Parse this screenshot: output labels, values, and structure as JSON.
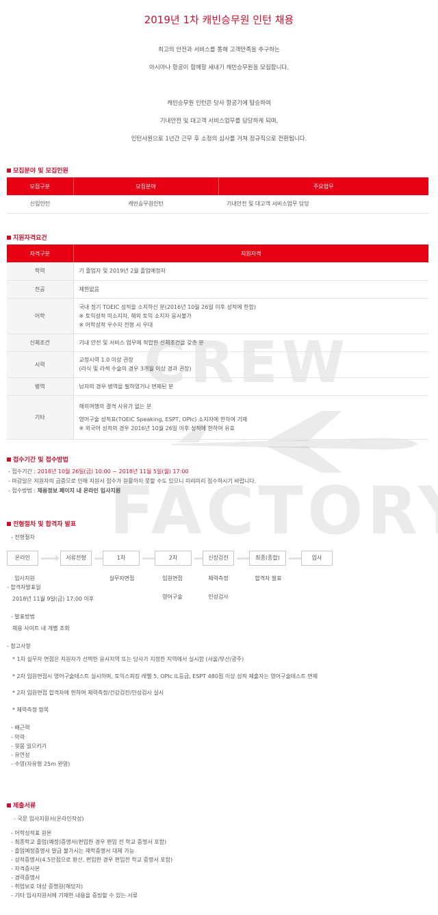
{
  "title": "2019년 1차 캐빈승무원 인턴 채용",
  "intro": [
    "최고의 안전과 서비스를 통해 고객만족을 추구하는",
    "아시아나 항공이 함께할 새내기 캐빈승무원을 모집합니다.",
    "캐빈승무원 인턴은 당사 항공기에 탑승하여",
    "기내안전 및 대고객 서비스업무를 담당하게 되며,",
    "인턴사원으로 1년간 근무 후 소정의 심사를 거쳐 정규직으로 전환됩니다."
  ],
  "watermark": {
    "line1": "CREW",
    "line2": "FACTORY"
  },
  "section1": {
    "title": "모집분야 및 모집인원",
    "headers": [
      "모집구분",
      "모집분야",
      "주요업무"
    ],
    "rows": [
      [
        "신입인턴",
        "캐빈승무원인턴",
        "기내안전 및 대고객 서비스업무 담당"
      ]
    ]
  },
  "section2": {
    "title": "지원자격요건",
    "headers": [
      "자격구분",
      "지원자격"
    ],
    "rows": [
      {
        "label": "학력",
        "lines": [
          "기 졸업자 및 2019년 2월 졸업예정자"
        ]
      },
      {
        "label": "전공",
        "lines": [
          "제한없음"
        ]
      },
      {
        "label": "어학",
        "lines": [
          "국내 정기 TOEIC 성적을 소지하신 분(2016년 10월 26일 이후 성적에 한함)",
          "※ 토익성적 미소지자, 해외 토익 소지자 응시불가",
          "※ 어학성적 우수자 전형 시 우대"
        ]
      },
      {
        "label": "신체조건",
        "lines": [
          "기내 안전 및 서비스 업무에 적합한 신체조건을 갖춘 분"
        ]
      },
      {
        "label": "시력",
        "lines": [
          "교정시력 1.0 이상 권장",
          "(라식 및 라섹 수술의 경우 3개월 이상 경과 권장)"
        ]
      },
      {
        "label": "병역",
        "lines": [
          "남자의 경우 병역을 필하였거나 면제된 분"
        ]
      },
      {
        "label": "기타",
        "lines": [
          "해외여행의 결격 사유가 없는 분",
          "",
          "영어구술 성적표(TOEIC Speaking, ESPT, OPIc) 소지자에 한하여 기재",
          "※ 외국어 성적의 경우 2016년 10월 26일 이후 성적에 한하여 유효"
        ]
      }
    ]
  },
  "section3": {
    "title": "접수기간 및 접수방법",
    "period_label": "- 접수기간 : ",
    "period_value": "2018년 10월 26일(금) 10:00 ~ 2018년 11월 5일(월) 17:00",
    "notice": "- 마감일은 지원자의 급증으로 인해 지원서 접수가 원활하지 못할 수도 있으니 미리미리 접수하시기 바랍니다.",
    "method_label": "- 접수방법 : ",
    "method_value": "채용정보 페이지 내 온라인 입사지원"
  },
  "section4": {
    "title": "전형절차 및 합격자 발표",
    "process_label": "- 전형절차",
    "steps": [
      "온라인",
      "서류전형",
      "1차",
      "2차",
      "신장검진",
      "최종(종합)",
      "입사"
    ],
    "subs": [
      "입사지원",
      "실무자면접",
      "임원면접",
      "체력측정",
      "합격자 발표"
    ],
    "subs2": [
      "영어구술",
      "인성검사"
    ],
    "announce_label": "- 합격자발표일",
    "announce_value": "2018년 11월 9일(금) 17:00 이후",
    "method_label": "- 발표방법",
    "method_value": "채용 사이트 내 개별 조회",
    "notes_label": "- 참고사항",
    "notes": [
      "* 1차 실무자 면접은 지원자가 선택한 응시지역 또는 당사가 지정한 지역에서 실시함 (서울/부산/광주)",
      "* 2차 임원면접시 영어구술테스트 실시하며, 토익스피킹 레벨 5, OPIc IL등급, ESPT 480점 이상 성적 제출자는 영어구술테스트 면제",
      "* 2차 임원면접 합격자에 한하여 체력측정/건강검진/인성검사 실시",
      "* 체력측정 항목"
    ],
    "fitness": [
      "- 배근력",
      "- 악력",
      "- 윗몸 일으키기",
      "- 유연성",
      "- 수영(자유형 25m 완영)"
    ]
  },
  "section5": {
    "title": "제출서류",
    "first": "- 국문 입사지원서(온라인작성)",
    "items": [
      "- 어학성적표 원본",
      "- 최종학교 졸업(예정)증명서(편입한 경우 편입 전 학교 증명서 포함)",
      "- 졸업예정증명서 발급 불가시는 재학증명서 대체 가능",
      "- 성적증명서(4.5만점으로 환산, 편입한 경우 편입전 학교 증명서 포함)",
      "- 자격증사본",
      "- 경력증명서",
      "- 취업보호 대상 증명원(해당자)",
      "- 기타 입사지원서에 기재한 내용을 증빙할 수 있는 서류"
    ]
  },
  "colors": {
    "accent": "#c8102e",
    "header_bg": "#e60012"
  }
}
